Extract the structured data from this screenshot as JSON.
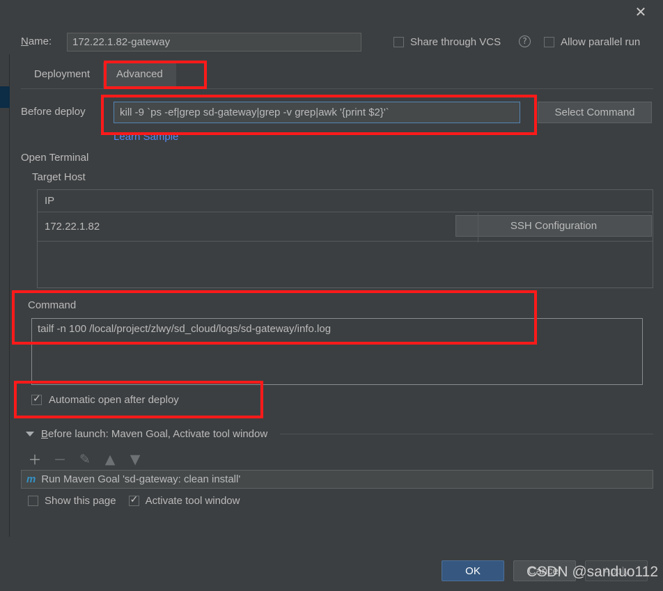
{
  "window": {
    "close_icon": "close-icon",
    "close_glyph": "✕"
  },
  "header": {
    "name_label_prefix": "N",
    "name_label_rest": "ame:",
    "name_value": "172.22.1.82-gateway",
    "share_vcs_label": "Share through VCS",
    "share_vcs_checked": false,
    "help_glyph": "?",
    "allow_parallel_label": "Allow parallel run",
    "allow_parallel_checked": false
  },
  "tabs": [
    {
      "label": "Deployment",
      "active": false
    },
    {
      "label": "Advanced",
      "active": true
    }
  ],
  "before_deploy": {
    "label": "Before deploy",
    "value": "kill -9 `ps -ef|grep sd-gateway|grep -v grep|awk '{print $2}'`",
    "select_command_label": "Select Command",
    "learn_sample_label": "Learn Sample"
  },
  "open_terminal": {
    "section_label": "Open Terminal",
    "target_host_label": "Target Host",
    "table": {
      "columns": [
        "IP"
      ],
      "rows": [
        [
          "172.22.1.82"
        ]
      ],
      "ssh_config_label": "SSH Configuration"
    },
    "command_label": "Command",
    "command_value": "tailf -n 100 /local/project/zlwy/sd_cloud/logs/sd-gateway/info.log",
    "auto_open_label": "Automatic open after deploy",
    "auto_open_checked": true
  },
  "before_launch": {
    "header_prefix": "B",
    "header_rest": "efore launch: Maven Goal, Activate tool window",
    "toolbar": [
      {
        "name": "add",
        "glyph": "＋",
        "enabled": true
      },
      {
        "name": "remove",
        "glyph": "－",
        "enabled": false
      },
      {
        "name": "edit",
        "glyph": "✎",
        "enabled": false
      },
      {
        "name": "move-up",
        "glyph": "▲",
        "enabled": false
      },
      {
        "name": "move-down",
        "glyph": "▼",
        "enabled": false
      }
    ],
    "items": [
      {
        "icon": "m",
        "label": "Run Maven Goal 'sd-gateway: clean install'"
      }
    ],
    "show_this_page_label": "Show this page",
    "show_this_page_checked": false,
    "activate_tool_window_label": "Activate tool window",
    "activate_tool_window_checked": true
  },
  "footer": {
    "ok_label": "OK",
    "cancel_label": "Cancel",
    "apply_label": "Apply"
  },
  "watermark": {
    "text": "CSDN @sanduo112"
  },
  "colors": {
    "background": "#3c3f41",
    "accent_blue": "#365880",
    "focus_border": "#5486b5",
    "link_blue": "#548af7",
    "annotation_red": "#ff1a1a",
    "selected_rail": "#0d2c45"
  }
}
